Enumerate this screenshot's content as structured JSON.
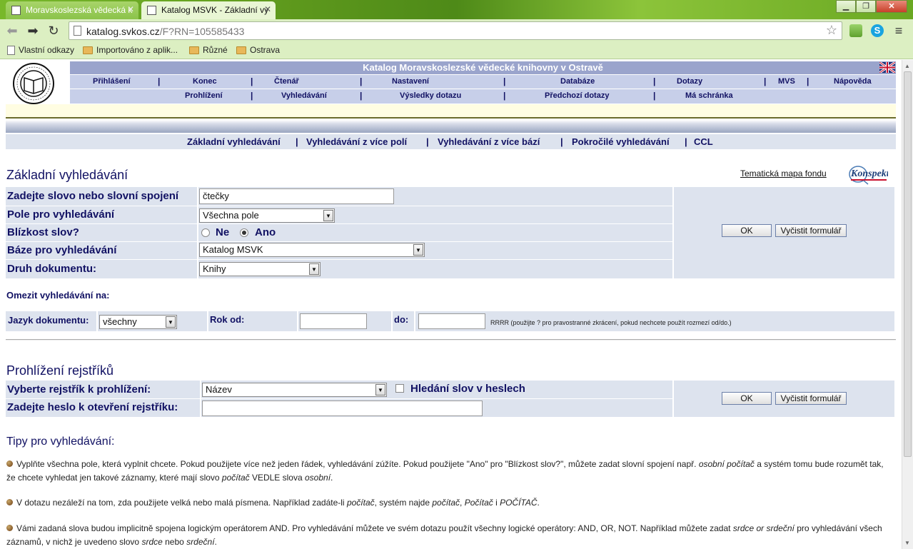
{
  "browser": {
    "tabs": [
      {
        "title": "Moravskoslezská vědecká k",
        "active": false
      },
      {
        "title": "Katalog MSVK - Základní vy",
        "active": true
      }
    ],
    "url_host": "katalog.svkos.cz",
    "url_rest": "/F?RN=105585433",
    "bookmarks": [
      "Vlastní odkazy",
      "Importováno z aplik...",
      "Různé",
      "Ostrava"
    ]
  },
  "header": {
    "title": "Katalog Moravskoslezské vědecké knihovny v Ostravě",
    "menu1": [
      "Přihlášení",
      "Konec",
      "Čtenář",
      "Nastavení",
      "Databáze",
      "Dotazy",
      "MVS",
      "Nápověda"
    ],
    "menu2": [
      "Prohlížení",
      "Vyhledávání",
      "Výsledky dotazu",
      "Předchozí dotazy",
      "Má schránka"
    ]
  },
  "subnav": [
    "Základní vyhledávání",
    "Vyhledávání z více polí",
    "Vyhledávání z více bází",
    "Pokročilé vyhledávání",
    "CCL"
  ],
  "basic_search": {
    "heading": "Základní vyhledávání",
    "map_link": "Tematická mapa fondu",
    "konspekt_logo": "Konspekt",
    "fields": {
      "word_label": "Zadejte slovo nebo slovní spojení",
      "word_value": "čtečky",
      "field_label": "Pole pro vyhledávání",
      "field_value": "Všechna pole",
      "proximity_label": "Blízkost slov?",
      "proximity_no": "Ne",
      "proximity_yes": "Ano",
      "proximity_selected": "Ano",
      "base_label": "Báze pro vyhledávání",
      "base_value": "Katalog MSVK",
      "doctype_label": "Druh dokumentu:",
      "doctype_value": "Knihy"
    },
    "ok": "OK",
    "clear": "Vyčistit formulář",
    "limit_title": "Omezit vyhledávání na:",
    "lang_label": "Jazyk dokumentu:",
    "lang_value": "všechny",
    "year_from_label": "Rok od:",
    "year_to_label": "do:",
    "year_hint": "RRRR (použijte ? pro pravostranné zkrácení, pokud nechcete použít rozmezí od/do.)"
  },
  "browse": {
    "heading": "Prohlížení rejstříků",
    "index_label": "Vyberte rejstřík k prohlížení:",
    "index_value": "Název",
    "words_in_headings": "Hledání slov v heslech",
    "heading_label": "Zadejte heslo k otevření rejstříku:",
    "ok": "OK",
    "clear": "Vyčistit formulář"
  },
  "tips": {
    "heading": "Tipy pro vyhledávání:",
    "t1a": "Vyplňte všechna pole, která vyplnit chcete. Pokud použijete více než jeden řádek, vyhledávání zúžíte. Pokud použijete \"Ano\" pro \"Blízkost slov?\", můžete zadat slovní spojení např. ",
    "t1b": "osobní počítač",
    "t1c": " a systém tomu bude rozumět tak, že chcete vyhledat jen takové záznamy, které mají slovo ",
    "t1d": "počítač",
    "t1e": " VEDLE slova ",
    "t1f": "osobní",
    "t1g": ".",
    "t2a": "V dotazu nezáleží na tom, zda použijete velká nebo malá písmena. Například zadáte-li ",
    "t2b": "počítač",
    "t2c": ", systém najde ",
    "t2d": "počítač",
    "t2e": ", ",
    "t2f": "Počítač",
    "t2g": " i ",
    "t2h": "POČÍTAČ",
    "t2i": ".",
    "t3a": "Vámi zadaná slova budou implicitně spojena logickým operátorem AND. Pro vyhledávání můžete ve svém dotazu použít všechny logické operátory: AND, OR, NOT. Například můžete zadat ",
    "t3b": "srdce or srdeční",
    "t3c": " pro vyhledávání všech záznamů, v nichž je uvedeno slovo ",
    "t3d": "srdce",
    "t3e": " nebo ",
    "t3f": "srdeční",
    "t3g": "."
  }
}
